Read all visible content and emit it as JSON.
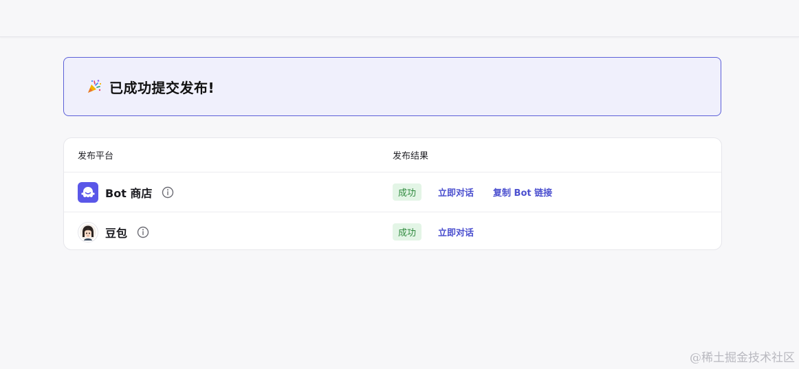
{
  "banner": {
    "icon": "party-popper-icon",
    "title": "已成功提交发布!"
  },
  "table": {
    "headers": {
      "platform": "发布平台",
      "result": "发布结果"
    },
    "rows": [
      {
        "icon": "bot-store-logo-icon",
        "platform": "Bot 商店",
        "status": "成功",
        "actions": [
          "立即对话",
          "复制 Bot 链接"
        ]
      },
      {
        "icon": "doubao-avatar-icon",
        "platform": "豆包",
        "status": "成功",
        "actions": [
          "立即对话"
        ]
      }
    ]
  },
  "watermark": "@稀土掘金技术社区",
  "colors": {
    "accent": "#4b4fcf",
    "banner_border": "#5b5fd8",
    "banner_bg": "#f0f0fc",
    "success_text": "#2f8a3e",
    "success_bg": "#e3f5e6"
  }
}
